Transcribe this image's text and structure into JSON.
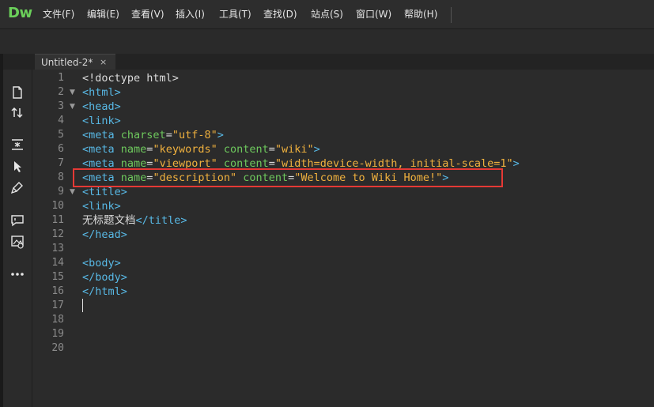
{
  "app": {
    "logo": "Dw"
  },
  "menu": {
    "items": [
      {
        "label": "文件(F)"
      },
      {
        "label": "编辑(E)"
      },
      {
        "label": "查看(V)"
      },
      {
        "label": "插入(I)"
      },
      {
        "label": "工具(T)"
      },
      {
        "label": "查找(D)"
      },
      {
        "label": "站点(S)"
      },
      {
        "label": "窗口(W)"
      },
      {
        "label": "帮助(H)"
      }
    ]
  },
  "tab": {
    "title": "Untitled-2*",
    "close_glyph": "×"
  },
  "toolbar": {
    "icons": [
      "new-document-icon",
      "sort-arrows-icon",
      "expand-collapse-icon",
      "select-pointer-icon",
      "format-brush-icon",
      "comment-icon",
      "image-icon",
      "more-icon"
    ]
  },
  "editor": {
    "lines": [
      "1",
      "2",
      "3",
      "4",
      "5",
      "6",
      "7",
      "8",
      "9",
      "10",
      "11",
      "12",
      "13",
      "14",
      "15",
      "16",
      "17",
      "18",
      "19",
      "20"
    ],
    "code": {
      "l1": "<!doctype html>",
      "l2": "<html>",
      "l3": "<head>",
      "l4": "<link>",
      "l5_tag": "<meta ",
      "l5_attr": "charset",
      "l5_eq": "=",
      "l5_val": "\"utf-8\"",
      "l5_end": ">",
      "l6_tag": "<meta ",
      "l6_a1": "name",
      "l6_eq1": "=",
      "l6_v1": "\"keywords\"",
      "l6_a2": " content",
      "l6_eq2": "=",
      "l6_v2": "\"wiki\"",
      "l6_end": ">",
      "l7_tag": "<meta ",
      "l7_a1": "name",
      "l7_eq1": "=",
      "l7_v1": "\"viewport\"",
      "l7_a2": " content",
      "l7_eq2": "=",
      "l7_v2": "\"width=device-width, initial-scale=1\"",
      "l7_end": ">",
      "l8_tag": "<meta ",
      "l8_a1": "name",
      "l8_eq1": "=",
      "l8_v1": "\"description\"",
      "l8_a2": " content",
      "l8_eq2": "=",
      "l8_v2": "\"Welcome to Wiki Home!\"",
      "l8_end": ">",
      "l9": "<title>",
      "l10": "<link>",
      "l11_text": "无标题文档",
      "l11_tag": "</title>",
      "l12": "</head>",
      "l14": "<body>",
      "l15": "</body>",
      "l16": "</html>"
    },
    "fold_glyph": "▼"
  },
  "colors": {
    "tag": "#58b9e6",
    "attr": "#6ec95d",
    "string": "#f0b13e",
    "highlight_border": "#e53935",
    "logo": "#6bd05a"
  }
}
